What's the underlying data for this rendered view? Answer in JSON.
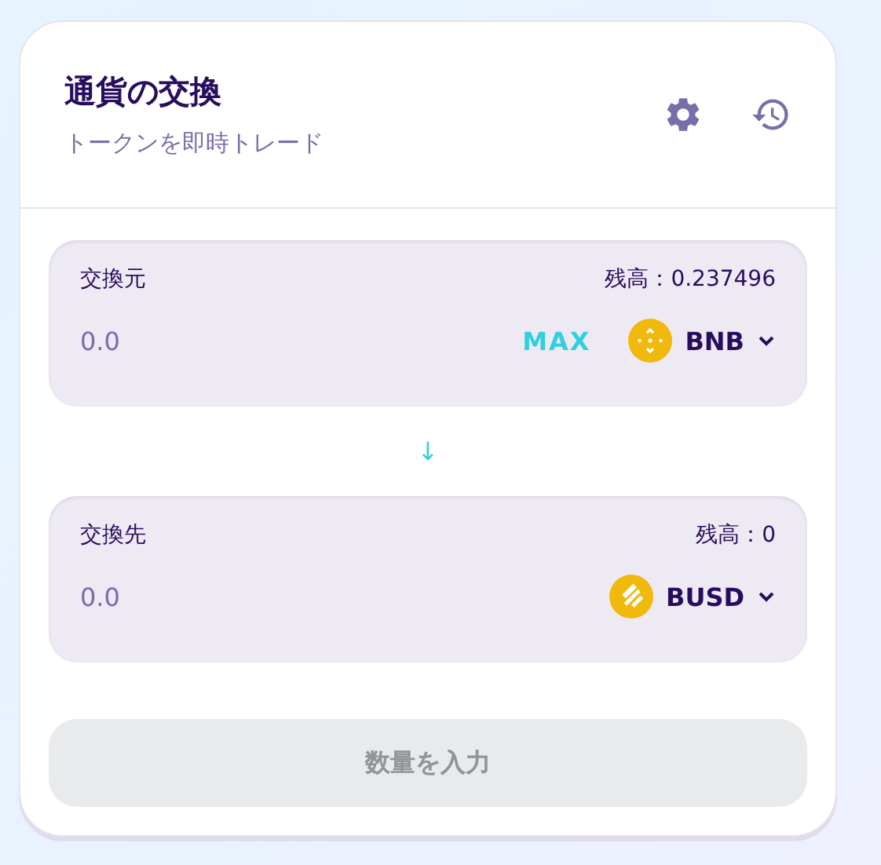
{
  "header": {
    "title": "通貨の交換",
    "subtitle": "トークンを即時トレード"
  },
  "panels": [
    {
      "label": "交換元",
      "balance": "残高：0.237496",
      "amount_placeholder": "0.0",
      "max_label": "MAX",
      "token": {
        "symbol": "BNB",
        "kind": "bnb"
      }
    },
    {
      "label": "交換先",
      "balance": "残高：0",
      "amount_placeholder": "0.0",
      "token": {
        "symbol": "BUSD",
        "kind": "busd"
      }
    }
  ],
  "swap_arrow": "↓",
  "action_button": {
    "label": "数量を入力",
    "disabled": true
  }
}
